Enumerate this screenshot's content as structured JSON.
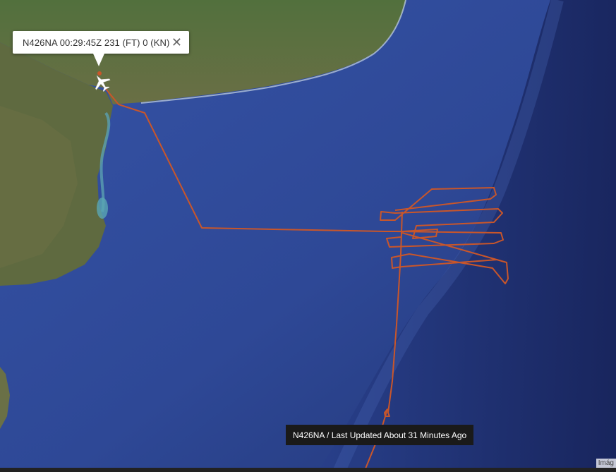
{
  "popup": {
    "text": "N426NA 00:29:45Z 231 (FT) 0 (KN)",
    "close_glyph": "✕"
  },
  "tooltip": {
    "text": "N426NA / Last Updated About 31 Minutes Ago"
  },
  "attribution": {
    "text": "Imág"
  },
  "colors": {
    "ocean": "#2f4a9e",
    "deep_ocean": "#1d2c6e",
    "land": "#4e6b3c",
    "track": "#c9562a",
    "aircraft": "#ffffff"
  },
  "icons": {
    "aircraft": "plane-icon",
    "close": "close-icon"
  }
}
